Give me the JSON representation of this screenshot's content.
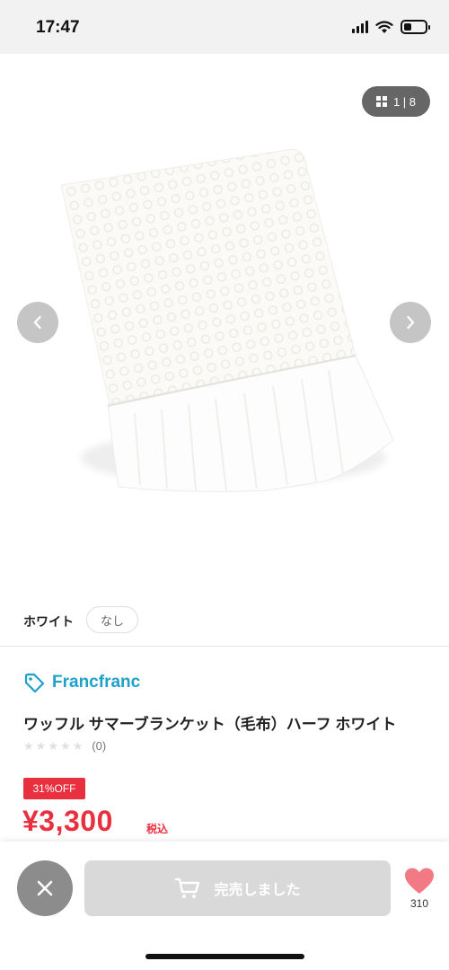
{
  "status_bar": {
    "time": "17:47",
    "battery_level": 0.35
  },
  "gallery": {
    "counter": "1 | 8",
    "current_image": 1,
    "total_images": 8
  },
  "variant": {
    "color": "ホワイト",
    "size": "なし"
  },
  "product": {
    "brand": "Francfranc",
    "title": "ワッフル サマーブランケット（毛布）ハーフ ホワイト",
    "rating": 0,
    "review_count": "(0)",
    "discount": "31%OFF",
    "price": "¥3,300",
    "tax_label": "税込"
  },
  "actions": {
    "soldout_label": "完売しました",
    "favorite_count": "310"
  },
  "colors": {
    "accent_red": "#e8303f",
    "brand_blue": "#1fa0c9",
    "favorite_pink": "#f27a85"
  }
}
